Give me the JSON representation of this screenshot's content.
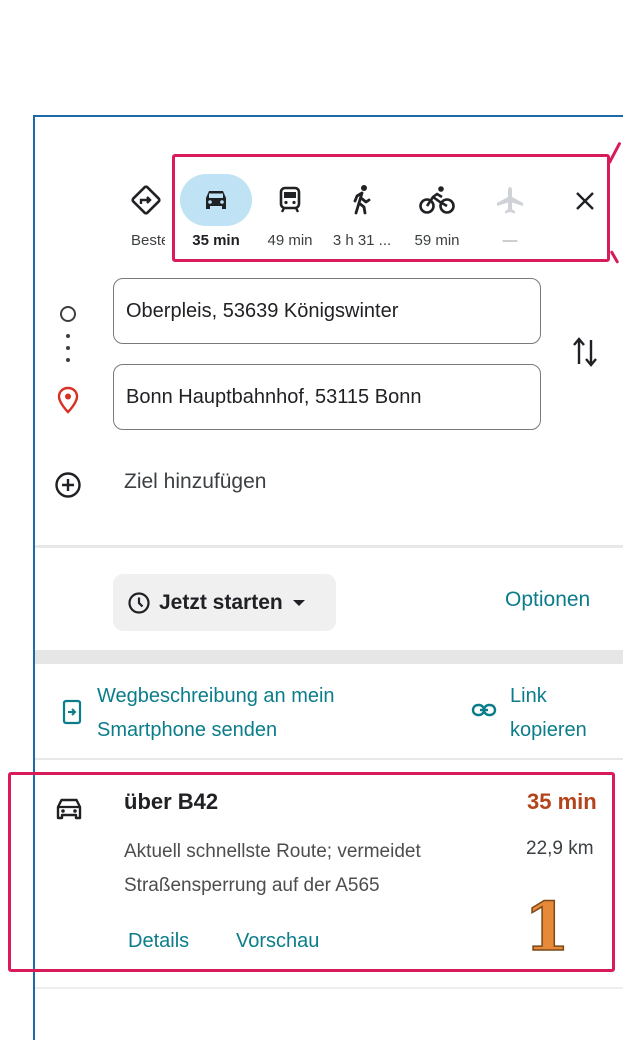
{
  "modes": [
    {
      "id": "best",
      "icon": "diamond-turn-icon",
      "label": "Beste"
    },
    {
      "id": "car",
      "icon": "car-icon",
      "label": "35 min",
      "active": true
    },
    {
      "id": "transit",
      "icon": "train-icon",
      "label": "49 min"
    },
    {
      "id": "walk",
      "icon": "walking-icon",
      "label": "3 h 31 ..."
    },
    {
      "id": "bike",
      "icon": "bicycle-icon",
      "label": "59 min"
    },
    {
      "id": "flight",
      "icon": "airplane-icon",
      "label": "—"
    }
  ],
  "close_icon": "close-icon",
  "origin": "Oberpleis, 53639 Königswinter",
  "destination": "Bonn Hauptbahnhof, 53115 Bonn",
  "add_stop": "Ziel hinzufügen",
  "depart": "Jetzt starten",
  "options": "Optionen",
  "send_line1": "Wegbeschreibung an mein",
  "send_line2": "Smartphone senden",
  "copy_line1": "Link",
  "copy_line2": "kopieren",
  "route": {
    "title": "über B42",
    "time": "35 min",
    "distance": "22,9 km",
    "desc_line1": "Aktuell schnellste Route; vermeidet",
    "desc_line2": "Straßensperrung auf der A565",
    "details": "Details",
    "preview": "Vorschau"
  },
  "annotations": {
    "step_number": "1",
    "edge_mark": "1"
  },
  "colors": {
    "accent": "#0b7d8a",
    "highlight": "#d81b5a",
    "active_bg": "#bfe3f5",
    "time": "#b3441b"
  }
}
